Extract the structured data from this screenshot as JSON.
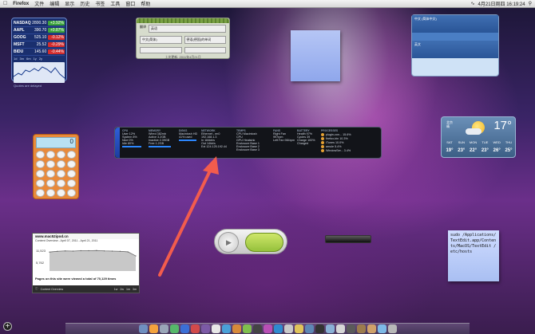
{
  "menubar": {
    "app": "Firefox",
    "menus": [
      "文件",
      "编辑",
      "显示",
      "历史",
      "书签",
      "工具",
      "窗口",
      "帮助"
    ],
    "clock": "4月21日周四 16:19:24"
  },
  "stocks": {
    "rows": [
      {
        "symbol": "NASDAQ",
        "price": "2800.30",
        "change": "+3.92%",
        "dir": "up"
      },
      {
        "symbol": "AAPL",
        "price": "390.70",
        "change": "+0.87%",
        "dir": "up"
      },
      {
        "symbol": "GOOG",
        "price": "525.10",
        "change": "-0.12%",
        "dir": "down"
      },
      {
        "symbol": "MSFT",
        "price": "25.52",
        "change": "-0.29%",
        "dir": "down"
      },
      {
        "symbol": "BIDU",
        "price": "145.60",
        "change": "-0.44%",
        "dir": "down"
      }
    ],
    "tabs": [
      "1d",
      "3m",
      "6m",
      "1y",
      "2y"
    ],
    "footer": "Quotes are delayed"
  },
  "greenpanel": {
    "left_label": "翻译",
    "left_value": "英语",
    "select_a": "中文(简体)",
    "select_b": "德语(德国)的单词",
    "footer": "上次更新: 2011年4月21日"
  },
  "globe": {
    "lang_a": "中文 (简体中文)",
    "lang_b": "英文"
  },
  "calculator": {
    "display": "0"
  },
  "istat": {
    "sections": [
      {
        "title": "CPU",
        "lines": [
          "User 12%",
          "System 8%",
          "Nice 0%",
          "Idle 80%"
        ]
      },
      {
        "title": "MEMORY",
        "lines": [
          "Wired 382mb",
          "Active 3.2GB",
          "Inactive 2.39GB",
          "Free 1.2GB"
        ]
      },
      {
        "title": "DISKS",
        "lines": [
          "Macintosh HD",
          "41% used"
        ]
      },
      {
        "title": "NETWORK",
        "lines": [
          "Ethernet - en0",
          "192.168.1.3",
          "In 184kb/s",
          "Out 14kb/s",
          "Ext 124.125.192.44"
        ]
      },
      {
        "title": "TEMPS",
        "lines": [
          "CPU Macintosh",
          "CPU",
          "GPU Heatsink",
          "Enclosure Base 1",
          "Enclosure Base 2",
          "Enclosure Base 3"
        ]
      },
      {
        "title": "FANS",
        "lines": [
          "Right Fan 997rpm",
          "Left Fan 984rpm"
        ]
      },
      {
        "title": "BATTERY",
        "lines": [
          "Health 97%",
          "Cycles 39",
          "Charge 100%",
          "Charged"
        ]
      },
      {
        "title": "PROCESSES",
        "lines": [
          "plugin-con... 15.6%",
          "firefox-bin 10.3%",
          "iTunes 10.0%",
          "amule 5.4%",
          "WindowSer... 3.4%"
        ]
      }
    ]
  },
  "weather": {
    "city": "北京",
    "condition": "晴",
    "temp": "17°",
    "days": [
      {
        "day": "SAT",
        "temp": "19°"
      },
      {
        "day": "SUN",
        "temp": "23°"
      },
      {
        "day": "MON",
        "temp": "22°"
      },
      {
        "day": "TUE",
        "temp": "23°"
      },
      {
        "day": "WED",
        "temp": "26°"
      },
      {
        "day": "THU",
        "temp": "25°"
      }
    ]
  },
  "visits": {
    "title": "www.mac52ipod.cn",
    "subtitle": "Content Overview - April 07, 2011 - April 21, 2011",
    "y_top": "11,523",
    "y_mid": "5,762",
    "caption": "Pages on this site were viewed a total of 70,129 times",
    "footer_label": "Content Overview",
    "ranges": [
      "1w",
      "2w",
      "1m",
      "3m"
    ]
  },
  "note_bottom": {
    "text": "sudo /Applications/TextEdit.app/Contents/MacOS/TextEdit /etc/hosts"
  },
  "chart_data": {
    "type": "line",
    "title": "www.mac52ipod.cn",
    "series": [
      {
        "values": [
          9800,
          10200,
          10400,
          10300,
          10500,
          10500,
          10600,
          10400,
          10300,
          10200,
          9900,
          7800
        ]
      }
    ],
    "ylim": [
      0,
      11523
    ]
  },
  "colors": {
    "accent_arrow": "#f25c4d",
    "stock_up": "#3ca33c",
    "stock_down": "#d32d2d"
  }
}
